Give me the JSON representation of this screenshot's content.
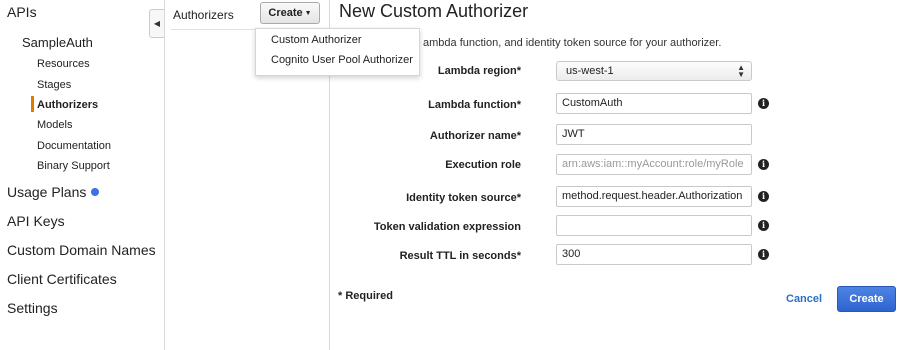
{
  "nav": {
    "apis": "APIs",
    "api_name": "SampleAuth",
    "sub_items": [
      "Resources",
      "Stages",
      "Authorizers",
      "Models",
      "Documentation",
      "Binary Support"
    ],
    "active_item": "Authorizers",
    "top_items": [
      "Usage Plans",
      "API Keys",
      "Custom Domain Names",
      "Client Certificates",
      "Settings"
    ],
    "collapse_icon": "caret-left-icon"
  },
  "authorizers_panel": {
    "title": "Authorizers",
    "create_label": "Create",
    "dropdown": [
      "Custom Authorizer",
      "Cognito User Pool Authorizer"
    ]
  },
  "form": {
    "title": "New Custom Authorizer",
    "subtitle": "ambda function, and identity token source for your authorizer.",
    "fields": {
      "lambda_region": {
        "label": "Lambda region*",
        "value": "us-west-1"
      },
      "lambda_function": {
        "label": "Lambda function*",
        "value": "CustomAuth"
      },
      "authorizer_name": {
        "label": "Authorizer name*",
        "value": "JWT"
      },
      "execution_role": {
        "label": "Execution role",
        "placeholder": "arn:aws:iam::myAccount:role/myRole"
      },
      "identity_source": {
        "label": "Identity token source*",
        "value": "method.request.header.Authorization"
      },
      "token_validation": {
        "label": "Token validation expression",
        "value": ""
      },
      "result_ttl": {
        "label": "Result TTL in seconds*",
        "value": "300"
      }
    },
    "required_note": "* Required",
    "cancel_label": "Cancel",
    "create_label": "Create",
    "info_glyph": "i"
  },
  "colors": {
    "active_bar": "#e07b00",
    "link": "#2a6fc9",
    "primary": "#3b6fd6",
    "dot": "#3b73e0"
  }
}
